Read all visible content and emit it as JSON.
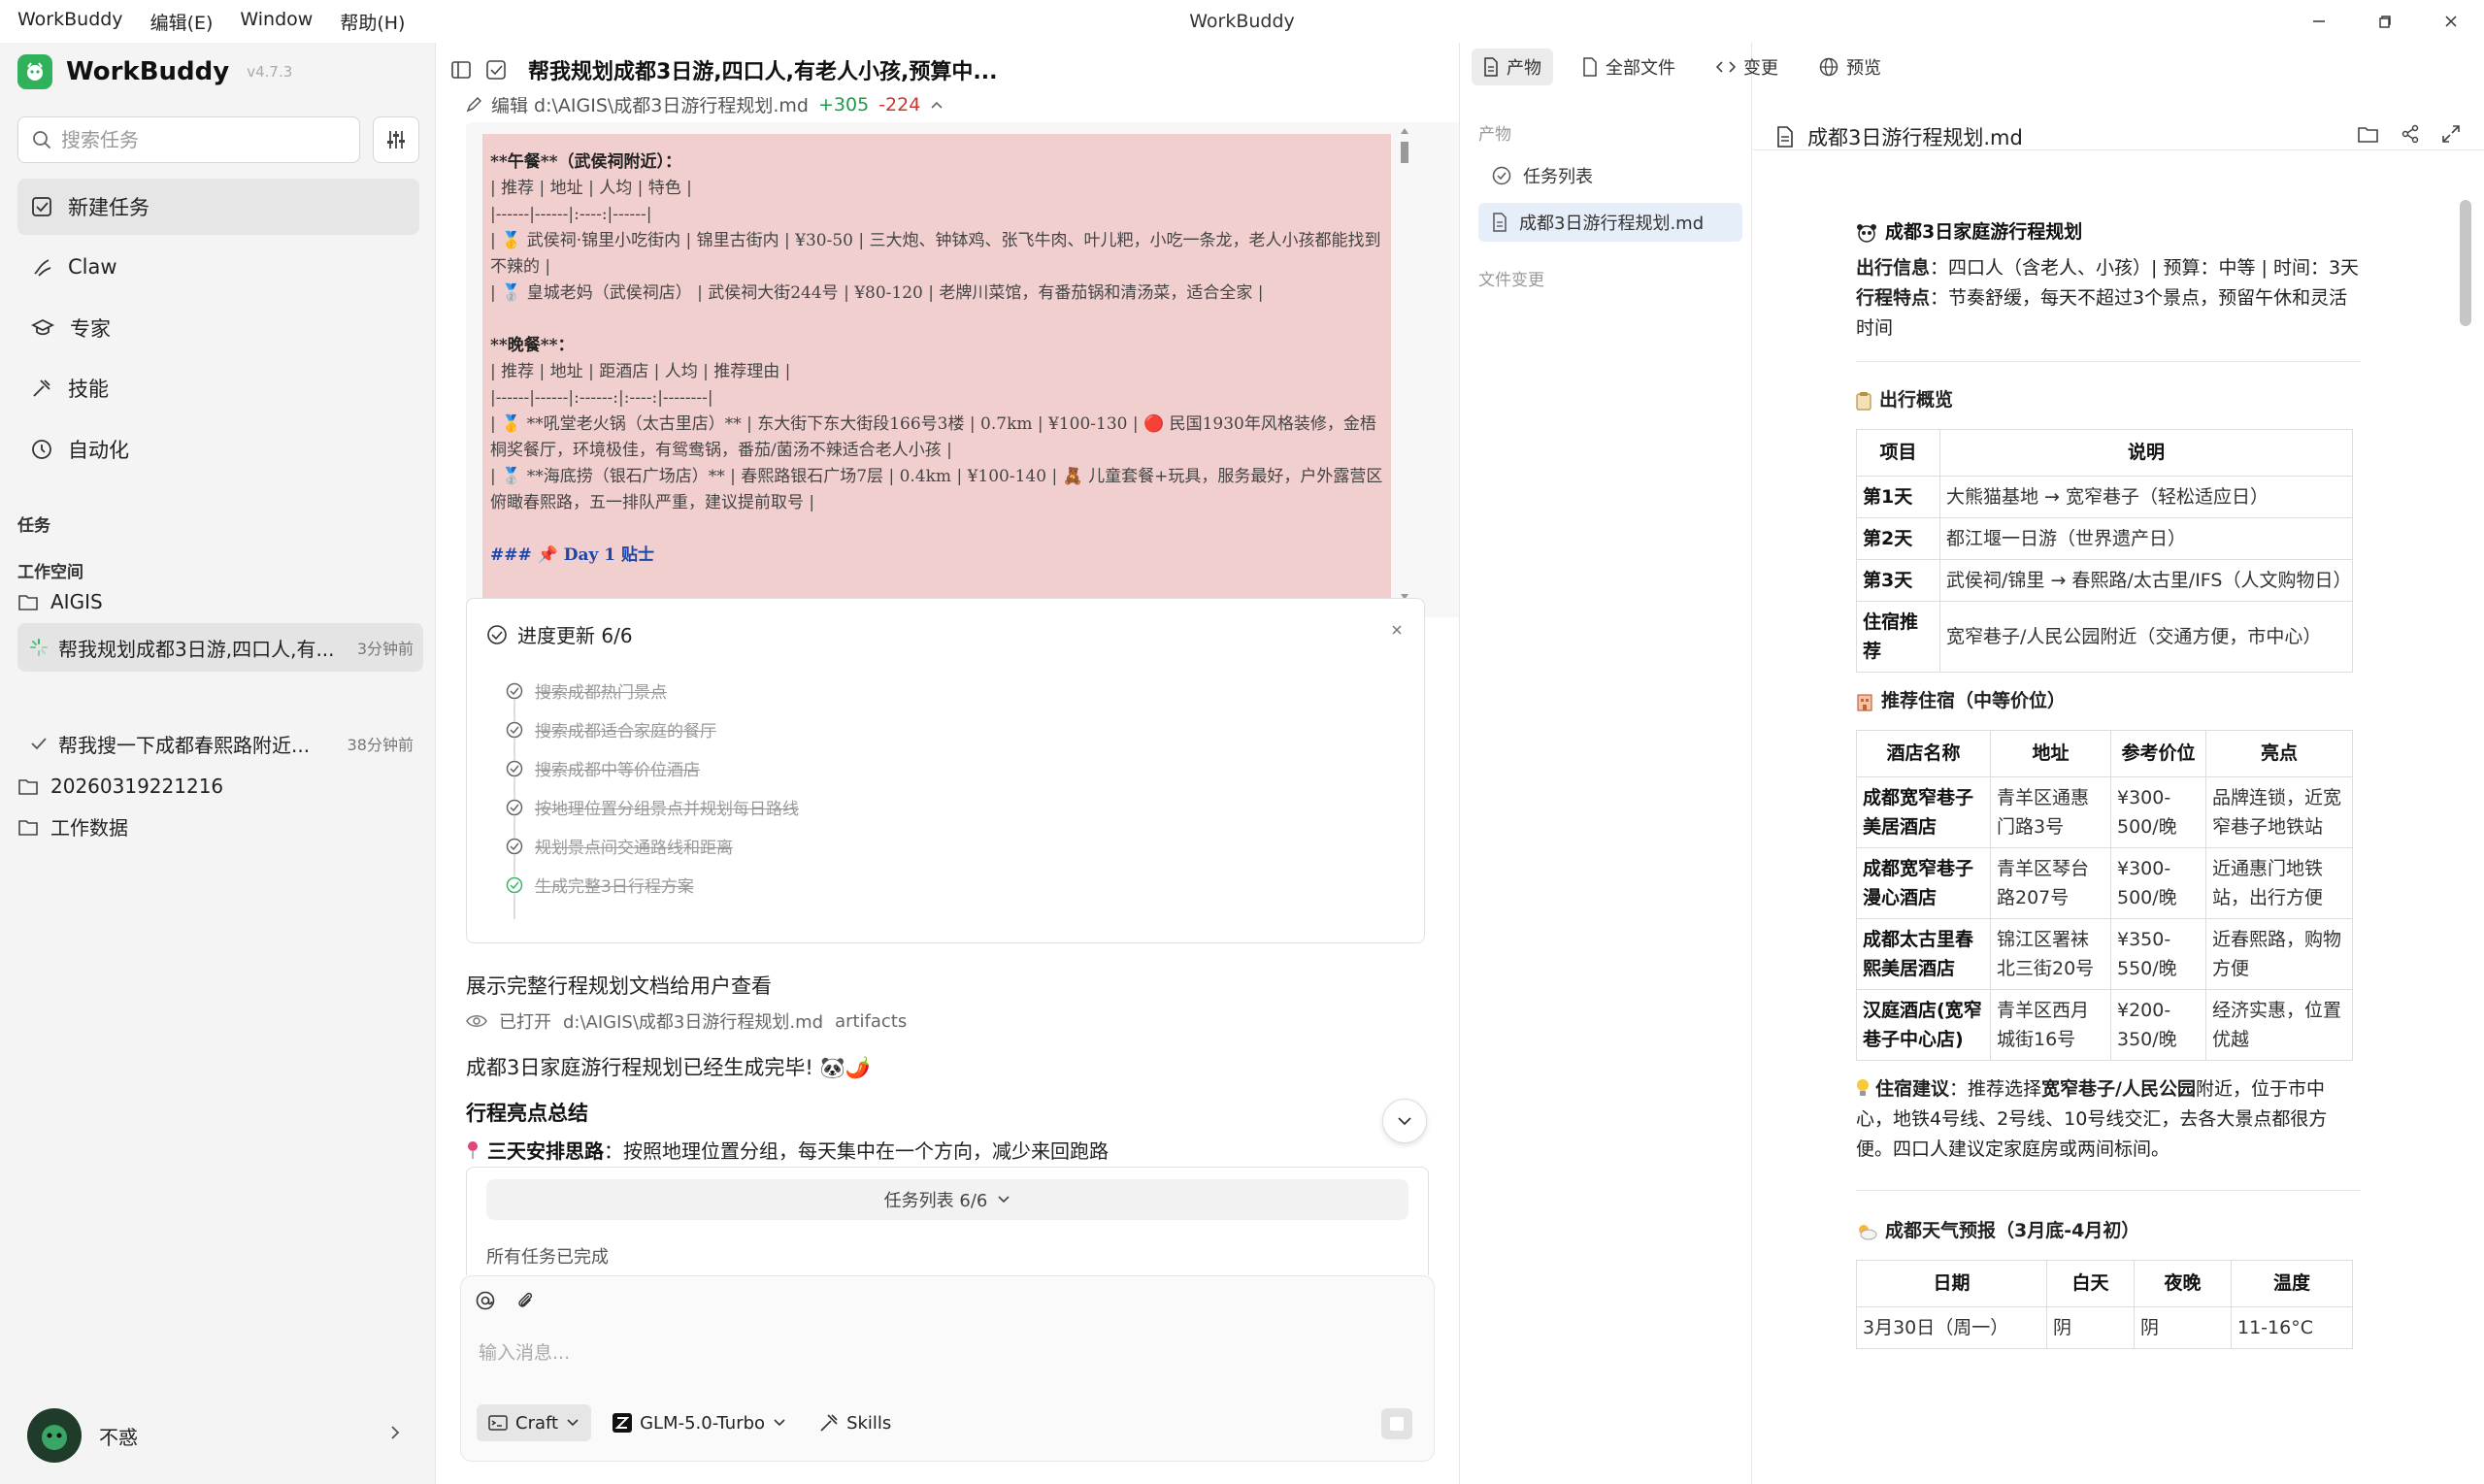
{
  "window": {
    "title": "WorkBuddy",
    "menu": [
      "WorkBuddy",
      "编辑(E)",
      "Window",
      "帮助(H)"
    ]
  },
  "sidebar": {
    "app_name": "WorkBuddy",
    "version": "v4.7.3",
    "search_placeholder": "搜索任务",
    "nav": [
      "新建任务",
      "Claw",
      "专家",
      "技能",
      "自动化"
    ],
    "section_tasks": "任务",
    "section_workspace": "工作空间",
    "workspace_root": "AIGIS",
    "tasks": [
      {
        "title": "帮我规划成都3日游,四口人,有...",
        "time": "3分钟前"
      },
      {
        "title": "帮我搜一下成都春熙路附近...",
        "time": "38分钟前"
      }
    ],
    "folders": [
      "20260319221216",
      "工作数据"
    ],
    "user": "不惑"
  },
  "chat": {
    "title": "帮我规划成都3日游,四口人,有老人小孩,预算中...",
    "edit_label": "编辑 d:\\AIGIS\\成都3日游行程规划.md",
    "added": "+305",
    "removed": "-224",
    "md_lines": [
      {
        "cls": "b",
        "text": "**午餐**（武侯祠附近）："
      },
      {
        "cls": "",
        "text": "| 推荐 | 地址 | 人均 | 特色 |"
      },
      {
        "cls": "",
        "text": "|------|------|:----:|------|"
      },
      {
        "cls": "",
        "text": "| 🥇 武侯祠·锦里小吃街内 | 锦里古街内 | ¥30-50 | 三大炮、钟钵鸡、张飞牛肉、叶儿粑，小吃一条龙，老人小孩都能找到不辣的 |"
      },
      {
        "cls": "",
        "text": "| 🥈 皇城老妈（武侯祠店） | 武侯祠大街244号 | ¥80-120 | 老牌川菜馆，有番茄锅和清汤菜，适合全家 |"
      },
      {
        "cls": "",
        "text": " "
      },
      {
        "cls": "b",
        "text": "**晚餐**："
      },
      {
        "cls": "",
        "text": "| 推荐 | 地址 | 距酒店 | 人均 | 推荐理由 |"
      },
      {
        "cls": "",
        "text": "|------|------|:------:|:----:|--------|"
      },
      {
        "cls": "",
        "text": "| 🥇 **吼堂老火锅（太古里店）** | 东大街下东大街段166号3楼 | 0.7km | ¥100-130 | 🔴 民国1930年风格装修，金梧桐奖餐厅，环境极佳，有鸳鸯锅，番茄/菌汤不辣适合老人小孩 |"
      },
      {
        "cls": "",
        "text": "| 🥈 **海底捞（银石广场店）** | 春熙路银石广场7层 | 0.4km | ¥100-140 | 🧸 儿童套餐+玩具，服务最好，户外露营区俯瞰春熙路，五一排队严重，建议提前取号 |"
      },
      {
        "cls": "",
        "text": " "
      },
      {
        "cls": "h",
        "text": "### 📌 Day 1 贴士"
      }
    ],
    "progress_title": "进度更新 6/6",
    "progress_steps": [
      "搜索成都热门景点",
      "搜索成都适合家庭的餐厅",
      "搜索成都中等价位酒店",
      "按地理位置分组景点并规划每日路线",
      "规划景点间交通路线和距离",
      "生成完整3日行程方案"
    ],
    "show_doc_text": "展示完整行程规划文档给用户查看",
    "opened_label": "已打开",
    "opened_path": "d:\\AIGIS\\成都3日游行程规划.md",
    "opened_suffix": "artifacts",
    "done_message": "成都3日家庭游行程规划已经生成完毕! 🐼🌶️",
    "summary_title": "行程亮点总结",
    "summary_label": "三天安排思路",
    "summary_text": "：按照地理位置分组，每天集中在一个方向，减少来回跑路",
    "tasklist_label": "任务列表 6/6",
    "tasks_done": "所有任务已完成",
    "input_placeholder": "输入消息...",
    "chip_mode": "Craft",
    "chip_model": "GLM-5.0-Turbo",
    "chip_skills": "Skills"
  },
  "tabs": [
    "产物",
    "全部文件",
    "变更",
    "预览"
  ],
  "artifacts": {
    "label": "产物",
    "items": [
      "任务列表",
      "成都3日游行程规划.md"
    ],
    "changes_label": "文件变更"
  },
  "doc": {
    "filename": "成都3日游行程规划.md",
    "title": "成都3日家庭游行程规划",
    "info_label": "出行信息",
    "info_text": "：四口人（含老人、小孩）| 预算：中等 | 时间：3天",
    "feature_label": "行程特点",
    "feature_text": "：节奏舒缓，每天不超过3个景点，预留午休和灵活时间",
    "overview_title": "出行概览",
    "overview_headers": [
      "项目",
      "说明"
    ],
    "overview_rows": [
      [
        "第1天",
        "大熊猫基地 → 宽窄巷子（轻松适应日）"
      ],
      [
        "第2天",
        "都江堰一日游（世界遗产日）"
      ],
      [
        "第3天",
        "武侯祠/锦里 → 春熙路/太古里/IFS（人文购物日）"
      ],
      [
        "住宿推荐",
        "宽窄巷子/人民公园附近（交通方便，市中心）"
      ]
    ],
    "hotel_title": "推荐住宿（中等价位）",
    "hotel_headers": [
      "酒店名称",
      "地址",
      "参考价位",
      "亮点"
    ],
    "hotel_rows": [
      [
        "成都宽窄巷子美居酒店",
        "青羊区通惠门路3号",
        "¥300-500/晚",
        "品牌连锁，近宽窄巷子地铁站"
      ],
      [
        "成都宽窄巷子漫心酒店",
        "青羊区琴台路207号",
        "¥300-500/晚",
        "近通惠门地铁站，出行方便"
      ],
      [
        "成都太古里春熙美居酒店",
        "锦江区署袜北三街20号",
        "¥350-550/晚",
        "近春熙路，购物方便"
      ],
      [
        "汉庭酒店(宽窄巷子中心店)",
        "青羊区西月城街16号",
        "¥200-350/晚",
        "经济实惠，位置优越"
      ]
    ],
    "tip_label": "住宿建议",
    "tip_pre": "：推荐选择",
    "tip_bold": "宽窄巷子/人民公园",
    "tip_post": "附近，位于市中心，地铁4号线、2号线、10号线交汇，去各大景点都很方便。四口人建议定家庭房或两间标间。",
    "weather_title": "成都天气预报（3月底-4月初）",
    "weather_headers": [
      "日期",
      "白天",
      "夜晚",
      "温度"
    ],
    "weather_rows": [
      [
        "3月30日（周一）",
        "阴",
        "阴",
        "11-16°C"
      ]
    ]
  },
  "colors": {
    "brand": "#2fb25b",
    "diff_bg": "#f2cfcf",
    "added": "#1e9b4a",
    "removed": "#d0342c",
    "active_artifact": "#e6eef9"
  }
}
